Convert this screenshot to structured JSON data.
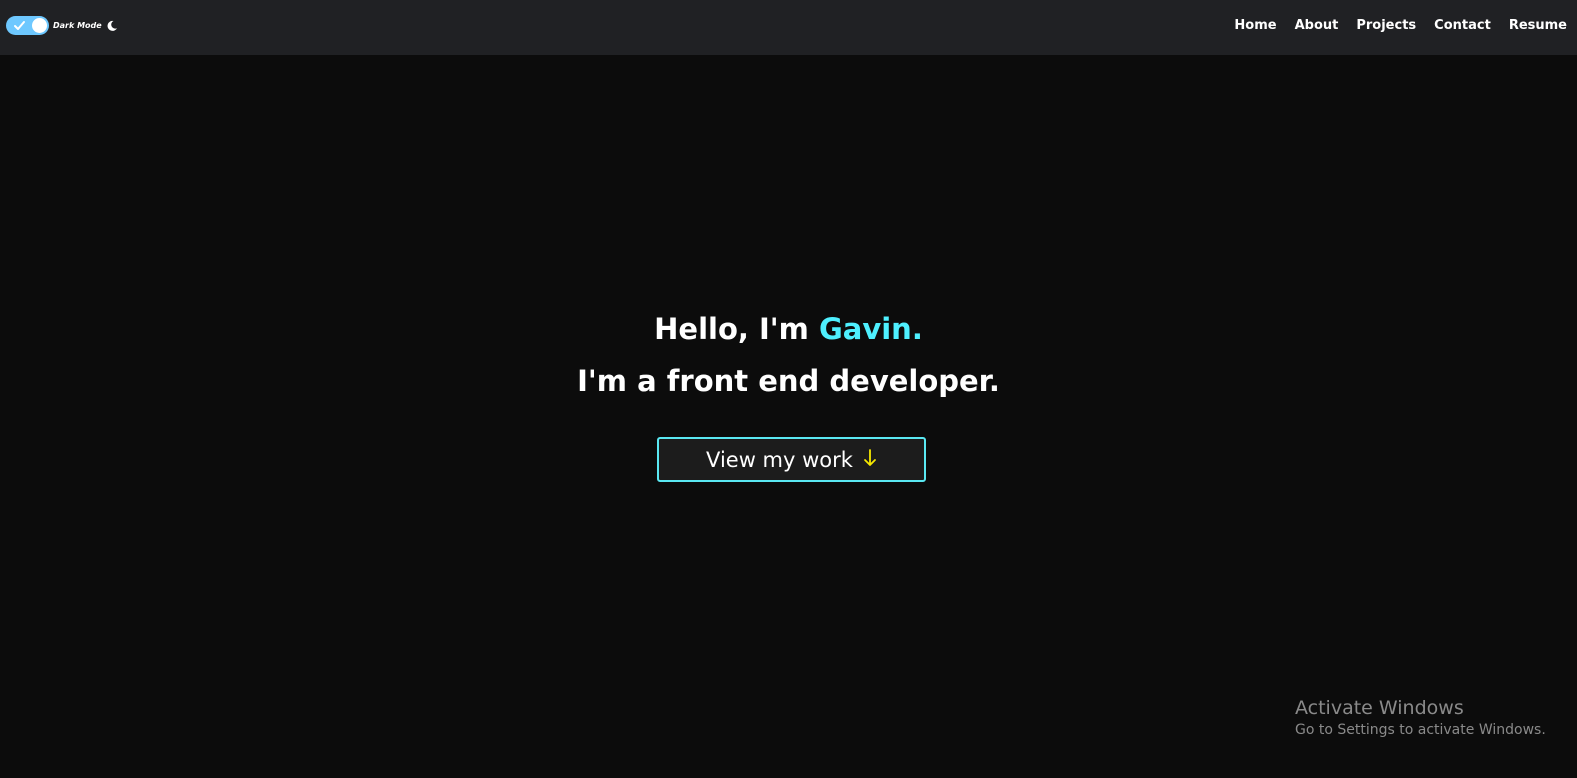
{
  "navbar": {
    "toggle": {
      "label": "Dark Mode",
      "checked": true,
      "icon": "moon-icon"
    },
    "links": [
      "Home",
      "About",
      "Projects",
      "Contact",
      "Resume"
    ]
  },
  "hero": {
    "greeting_prefix": "Hello, I'm ",
    "name": "Gavin.",
    "tagline": "I'm a front end developer.",
    "cta_label": "View my work",
    "cta_icon": "arrow-down-icon"
  },
  "watermark": {
    "title": "Activate Windows",
    "subtitle": "Go to Settings to activate Windows."
  },
  "colors": {
    "background": "#0c0c0c",
    "navbar": "#202124",
    "accent": "#4ef0ff",
    "arrow": "#f5e800",
    "toggle": "#6ec8ff"
  }
}
